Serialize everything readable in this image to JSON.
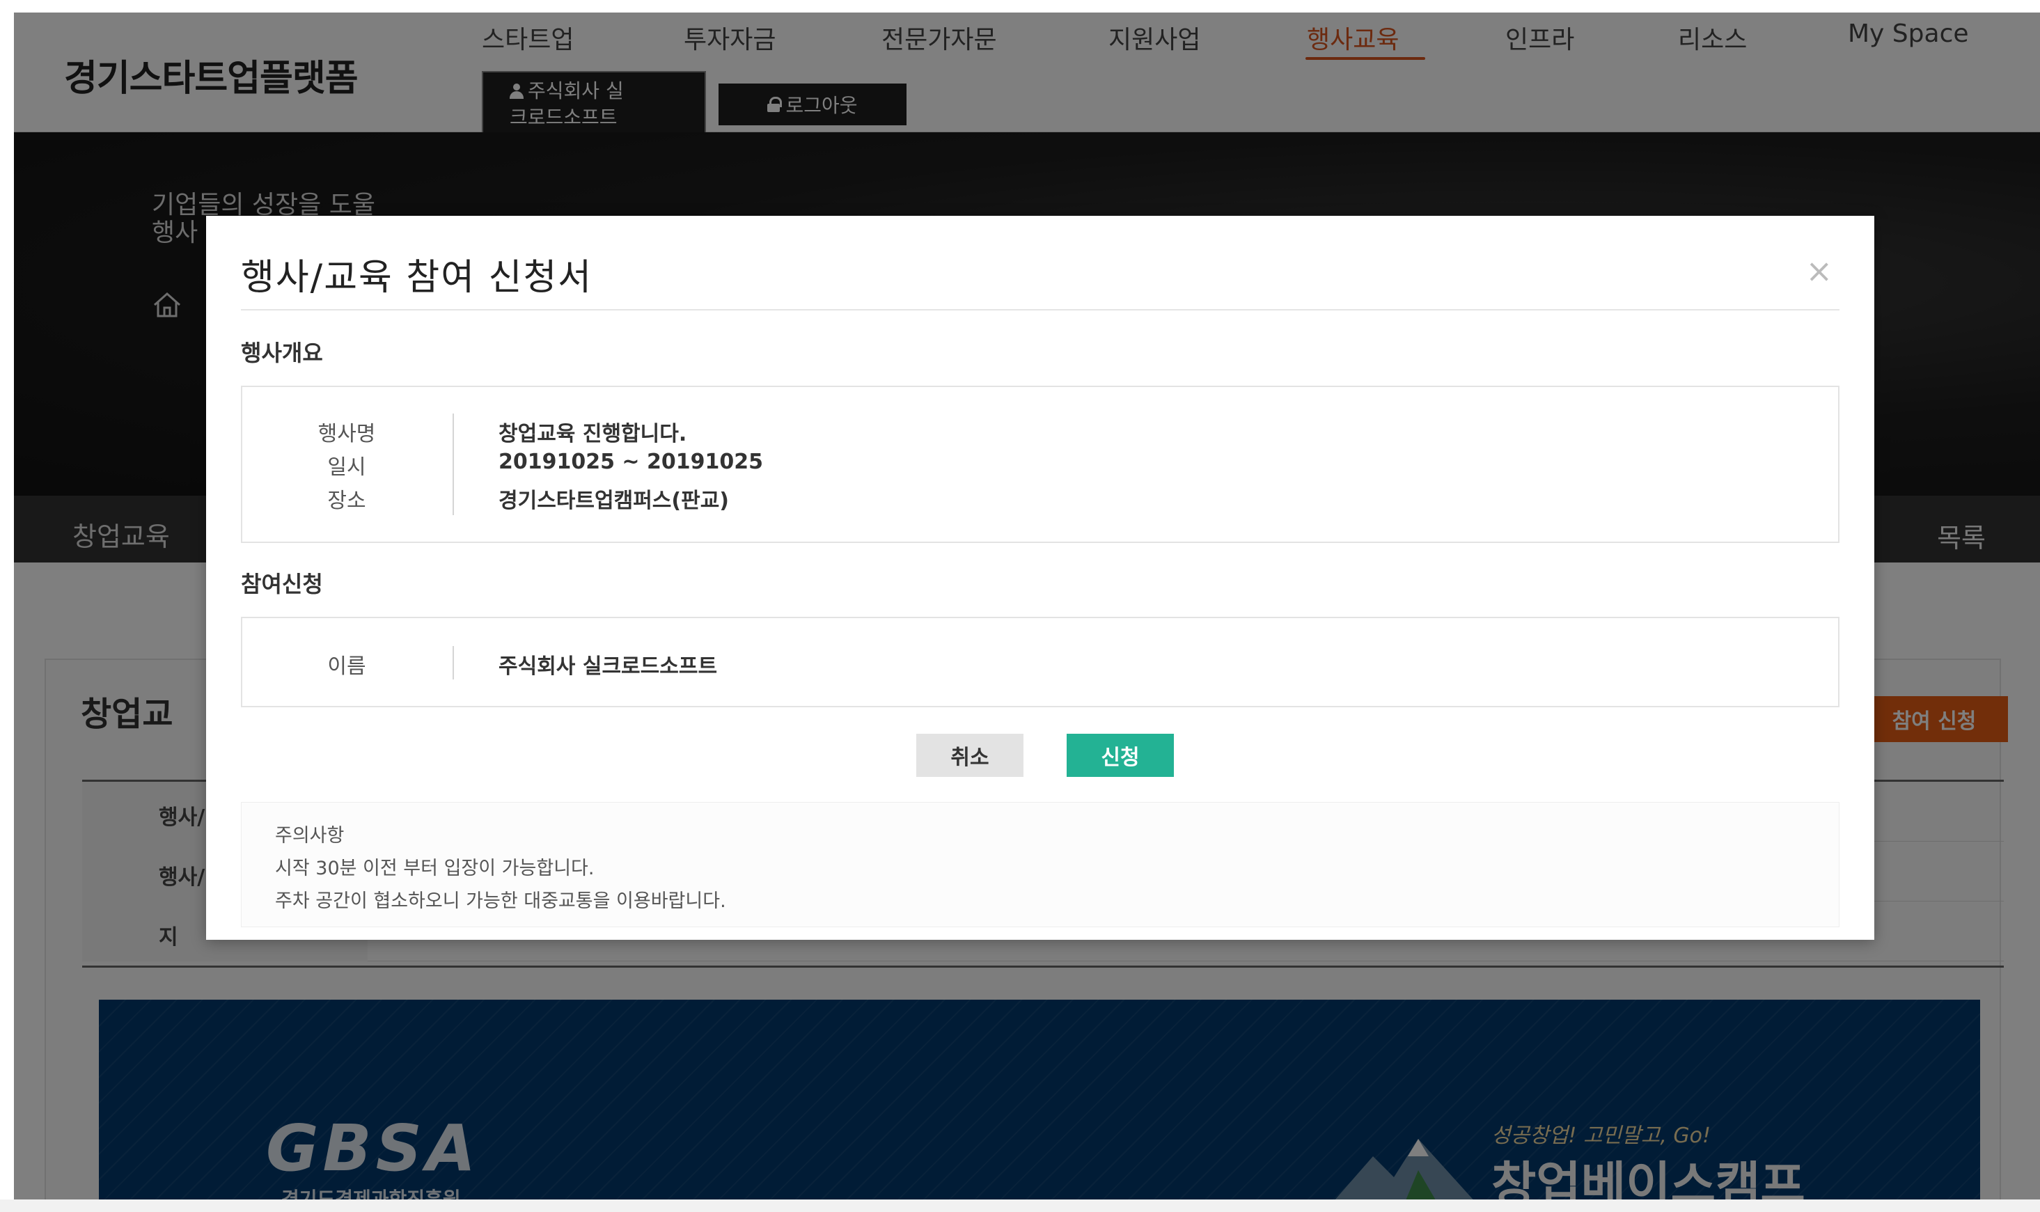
{
  "header": {
    "logo": "경기스타트업플랫폼",
    "nav": [
      {
        "label": "스타트업",
        "active": false
      },
      {
        "label": "투자자금",
        "active": false
      },
      {
        "label": "전문가자문",
        "active": false
      },
      {
        "label": "지원사업",
        "active": false
      },
      {
        "label": "행사교육",
        "active": true
      },
      {
        "label": "인프라",
        "active": false
      },
      {
        "label": "리소스",
        "active": false
      },
      {
        "label": "My Space",
        "active": false
      }
    ],
    "user_button_line1": "주식회사 실",
    "user_button_line2": "크로드소프트",
    "logout_label": "로그아웃"
  },
  "hero": {
    "tagline_line1": "기업들의 성장을 도울",
    "tagline_line2": "행사"
  },
  "subnav": {
    "left_label": "창업교육",
    "right_label": "목록"
  },
  "background_content": {
    "section_title": "창업교",
    "apply_button": "참여 신청",
    "table_labels": [
      "행사/",
      "행사/",
      "지"
    ],
    "banner": {
      "logo_text": "GBSA",
      "logo_subtitle": "경기도경제과학진흥원",
      "camp_tagline": "성공창업! 고민말고, Go!",
      "camp_title": "창업베이스캠프"
    }
  },
  "modal": {
    "title": "행사/교육 참여 신청서",
    "close_symbol": "×",
    "overview_heading": "행사개요",
    "overview": [
      {
        "label": "행사명",
        "value": "창업교육 진행합니다."
      },
      {
        "label": "일시",
        "value": "20191025 ~ 20191025"
      },
      {
        "label": "장소",
        "value": "경기스타트업캠퍼스(판교)"
      }
    ],
    "apply_heading": "참여신청",
    "apply_fields": [
      {
        "label": "이름",
        "value": "주식회사 실크로드소프트"
      }
    ],
    "cancel_label": "취소",
    "submit_label": "신청",
    "notice": {
      "title": "주의사항",
      "lines": [
        "시작 30분 이전 부터 입장이 가능합니다.",
        "주차 공간이 협소하오니 가능한 대중교통을 이용바랍니다."
      ]
    }
  },
  "colors": {
    "accent": "#d9541e",
    "submit": "#23b294",
    "apply_orange": "#e45d14",
    "banner_blue": "#03396c"
  }
}
